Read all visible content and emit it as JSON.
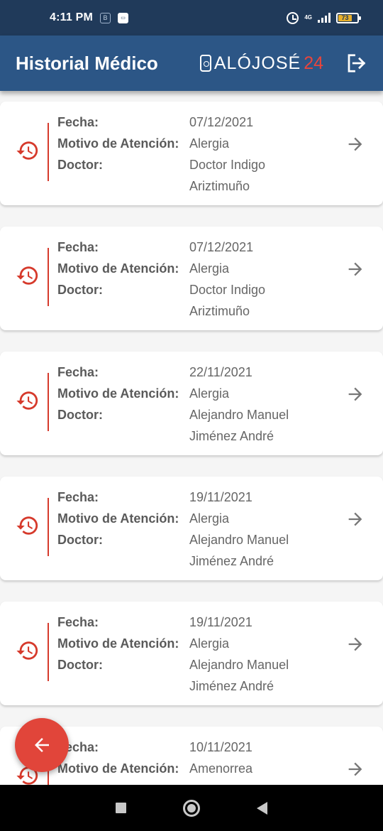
{
  "status_bar": {
    "time": "4:11 PM",
    "network": "4G",
    "battery": "73"
  },
  "header": {
    "title": "Historial Médico",
    "brand_text": "ALÓJOSÉ",
    "brand_number": "24"
  },
  "labels": {
    "date": "Fecha:",
    "reason": "Motivo de Atención:",
    "doctor": "Doctor:"
  },
  "records": [
    {
      "date": "07/12/2021",
      "reason": "Alergia",
      "doctor_line1": "Doctor Indigo",
      "doctor_line2": "Ariztimuño"
    },
    {
      "date": "07/12/2021",
      "reason": "Alergia",
      "doctor_line1": "Doctor Indigo",
      "doctor_line2": "Ariztimuño"
    },
    {
      "date": "22/11/2021",
      "reason": "Alergia",
      "doctor_line1": "Alejandro Manuel",
      "doctor_line2": "Jiménez André"
    },
    {
      "date": "19/11/2021",
      "reason": "Alergia",
      "doctor_line1": "Alejandro Manuel",
      "doctor_line2": "Jiménez André"
    },
    {
      "date": "19/11/2021",
      "reason": "Alergia",
      "doctor_line1": "Alejandro Manuel",
      "doctor_line2": "Jiménez André"
    },
    {
      "date": "10/11/2021",
      "reason": "Amenorrea",
      "doctor_line1": "",
      "doctor_line2": ""
    }
  ],
  "colors": {
    "status_bar": "#203a5a",
    "app_bar": "#2c5686",
    "accent_red": "#d63a2c",
    "fab": "#e1453a"
  },
  "icons": {
    "record": "history-icon",
    "open": "arrow-right-icon",
    "logout": "logout-icon",
    "back": "arrow-left-icon"
  }
}
